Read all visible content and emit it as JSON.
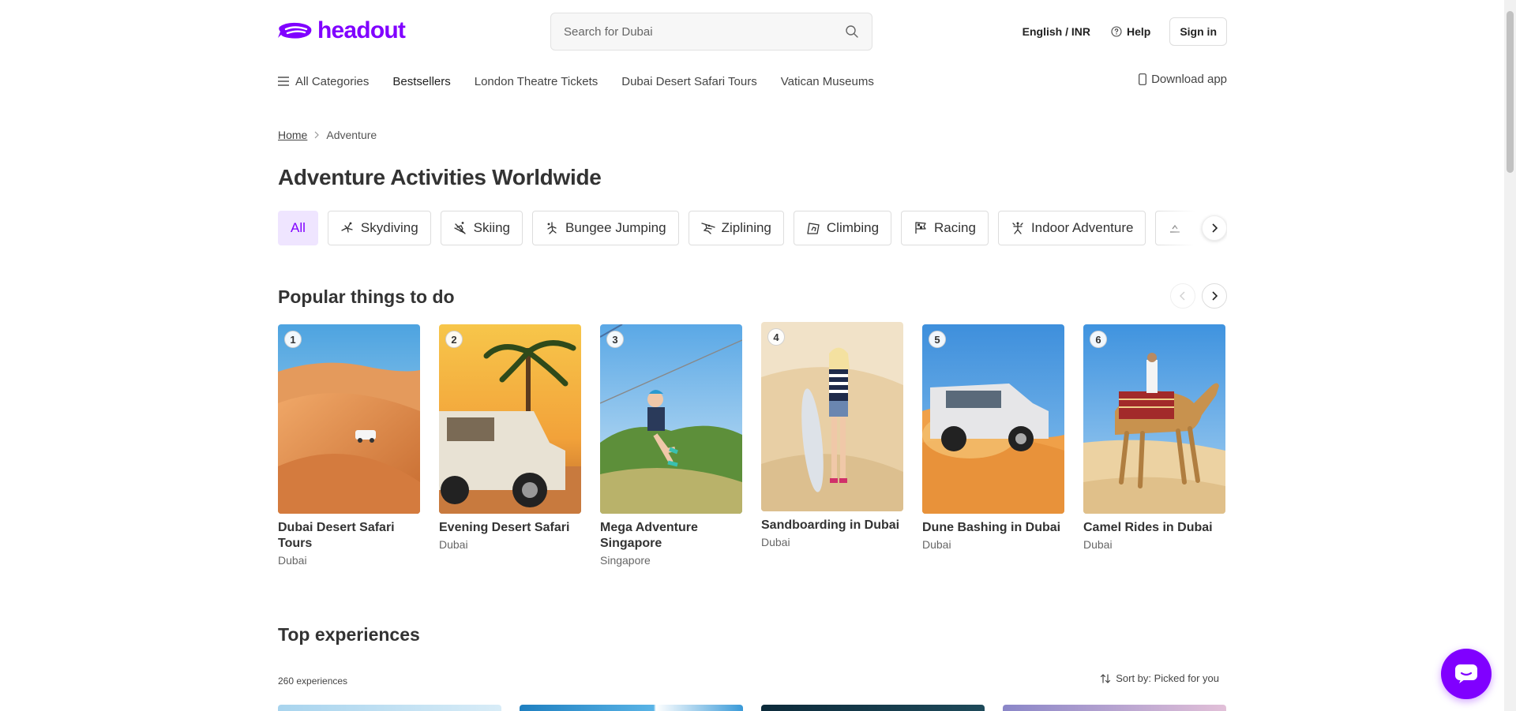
{
  "header": {
    "logo_text": "headout",
    "search_placeholder": "Search for Dubai",
    "language": "English / INR",
    "help": "Help",
    "signin": "Sign in"
  },
  "nav": {
    "all_categories": "All Categories",
    "links": [
      "Bestsellers",
      "London Theatre Tickets",
      "Dubai Desert Safari Tours",
      "Vatican Museums"
    ],
    "download": "Download app"
  },
  "breadcrumb": {
    "home": "Home",
    "current": "Adventure"
  },
  "page_title": "Adventure Activities Worldwide",
  "chips": [
    {
      "label": "All",
      "icon": "",
      "active": true
    },
    {
      "label": "Skydiving",
      "icon": "skydiving-icon"
    },
    {
      "label": "Skiing",
      "icon": "skiing-icon"
    },
    {
      "label": "Bungee Jumping",
      "icon": "bungee-jumping-icon"
    },
    {
      "label": "Ziplining",
      "icon": "ziplining-icon"
    },
    {
      "label": "Climbing",
      "icon": "climbing-icon"
    },
    {
      "label": "Racing",
      "icon": "racing-flag-icon"
    },
    {
      "label": "Indoor Adventure",
      "icon": "indoor-adventure-icon"
    },
    {
      "label": "",
      "icon": "faded-category-icon"
    }
  ],
  "popular": {
    "title": "Popular things to do",
    "items": [
      {
        "rank": "1",
        "name": "Dubai Desert Safari Tours",
        "city": "Dubai",
        "image": "desert-dunes-suv-image"
      },
      {
        "rank": "2",
        "name": "Evening Desert Safari",
        "city": "Dubai",
        "image": "palm-tree-jeep-image"
      },
      {
        "rank": "3",
        "name": "Mega Adventure Singapore",
        "city": "Singapore",
        "image": "zipline-rider-image"
      },
      {
        "rank": "4",
        "name": "Sandboarding in Dubai",
        "city": "Dubai",
        "image": "sandboarder-image"
      },
      {
        "rank": "5",
        "name": "Dune Bashing in Dubai",
        "city": "Dubai",
        "image": "dune-bashing-suv-image"
      },
      {
        "rank": "6",
        "name": "Camel Rides in Dubai",
        "city": "Dubai",
        "image": "camel-rider-image"
      }
    ]
  },
  "top_experiences": {
    "title": "Top experiences",
    "count": "260 experiences",
    "sort": "Sort by: Picked for you"
  },
  "colors": {
    "brand": "#8000ff",
    "chip_active_bg": "#efe5ff",
    "text": "#333333",
    "border": "#dddddd"
  }
}
